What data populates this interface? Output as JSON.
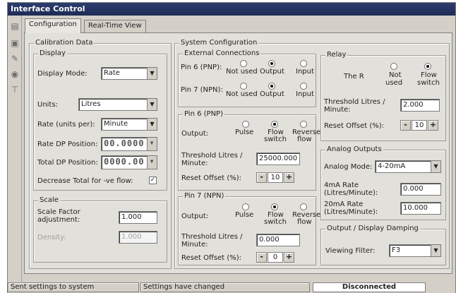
{
  "window": {
    "title": "Interface Control"
  },
  "tabs": [
    {
      "label": "Configuration"
    },
    {
      "label": "Real-Time View"
    }
  ],
  "toolbar_icons": [
    "document-icon",
    "save-icon",
    "tool-icon",
    "play-icon",
    "pin-icon"
  ],
  "calibration": {
    "title": "Calibration Data",
    "display": {
      "title": "Display",
      "display_mode_label": "Display Mode:",
      "display_mode_value": "Rate",
      "units_label": "Units:",
      "units_value": "Litres",
      "rate_units_label": "Rate (units per):",
      "rate_units_value": "Minute",
      "rate_dp_label": "Rate DP Position:",
      "rate_dp_value": "00.0000",
      "total_dp_label": "Total DP Position:",
      "total_dp_value": "0000.00",
      "decrease_total_label": "Decrease Total for -ve flow:",
      "decrease_total_checked": true
    },
    "scale": {
      "title": "Scale",
      "scale_factor_label_1": "Scale Factor",
      "scale_factor_label_2": "adjustment:",
      "scale_factor_value": "1.000",
      "density_label": "Density:",
      "density_value": "1.000"
    }
  },
  "system": {
    "title": "System Configuration",
    "external": {
      "title": "External Connections",
      "pin6_label": "Pin 6 (PNP):",
      "pin7_label": "Pin 7 (NPN):",
      "options": [
        "Not used",
        "Output",
        "Input"
      ],
      "pin6_selected": "Output",
      "pin7_selected": "Output"
    },
    "pin6": {
      "title": "Pin 6 (PNP)",
      "output_label": "Output:",
      "options": [
        [
          "Pulse",
          ""
        ],
        [
          "Flow",
          "switch"
        ],
        [
          "Reverse",
          "flow"
        ]
      ],
      "selected": "Flow switch",
      "threshold_label_1": "Threshold Litres /",
      "threshold_label_2": "Minute:",
      "threshold_value": "25000.000",
      "reset_label": "Reset Offset (%):",
      "reset_value": "10"
    },
    "pin7": {
      "title": "Pin 7 (NPN)",
      "output_label": "Output:",
      "options": [
        [
          "Pulse",
          ""
        ],
        [
          "Flow",
          "switch"
        ],
        [
          "Reverse",
          "flow"
        ]
      ],
      "selected": "Flow switch",
      "threshold_label_1": "Threshold Litres /",
      "threshold_label_2": "Minute:",
      "threshold_value": "0.000",
      "reset_label": "Reset Offset (%):",
      "reset_value": "0"
    }
  },
  "relay": {
    "title": "Relay",
    "the_label": "The R",
    "options": [
      [
        "Not",
        "used"
      ],
      [
        "Flow",
        "switch"
      ]
    ],
    "selected": "Flow switch",
    "threshold_label_1": "Threshold Litres /",
    "threshold_label_2": "Minute:",
    "threshold_value": "2.000",
    "reset_label": "Reset Offset (%):",
    "reset_value": "10"
  },
  "analog": {
    "title": "Analog Outputs",
    "mode_label": "Analog Mode:",
    "mode_value": "4-20mA",
    "rate4_label_1": "4mA Rate",
    "rate4_label_2": "(Litres/Minute):",
    "rate4_value": "0.000",
    "rate20_label_1": "20mA Rate",
    "rate20_label_2": "(Litres/Minute):",
    "rate20_value": "10.000"
  },
  "damping": {
    "title": "Output / Display Damping",
    "filter_label": "Viewing Filter:",
    "filter_value": "F3"
  },
  "status": {
    "left": "Sent settings to system",
    "middle": "Settings have changed",
    "right": "Disconnected"
  }
}
